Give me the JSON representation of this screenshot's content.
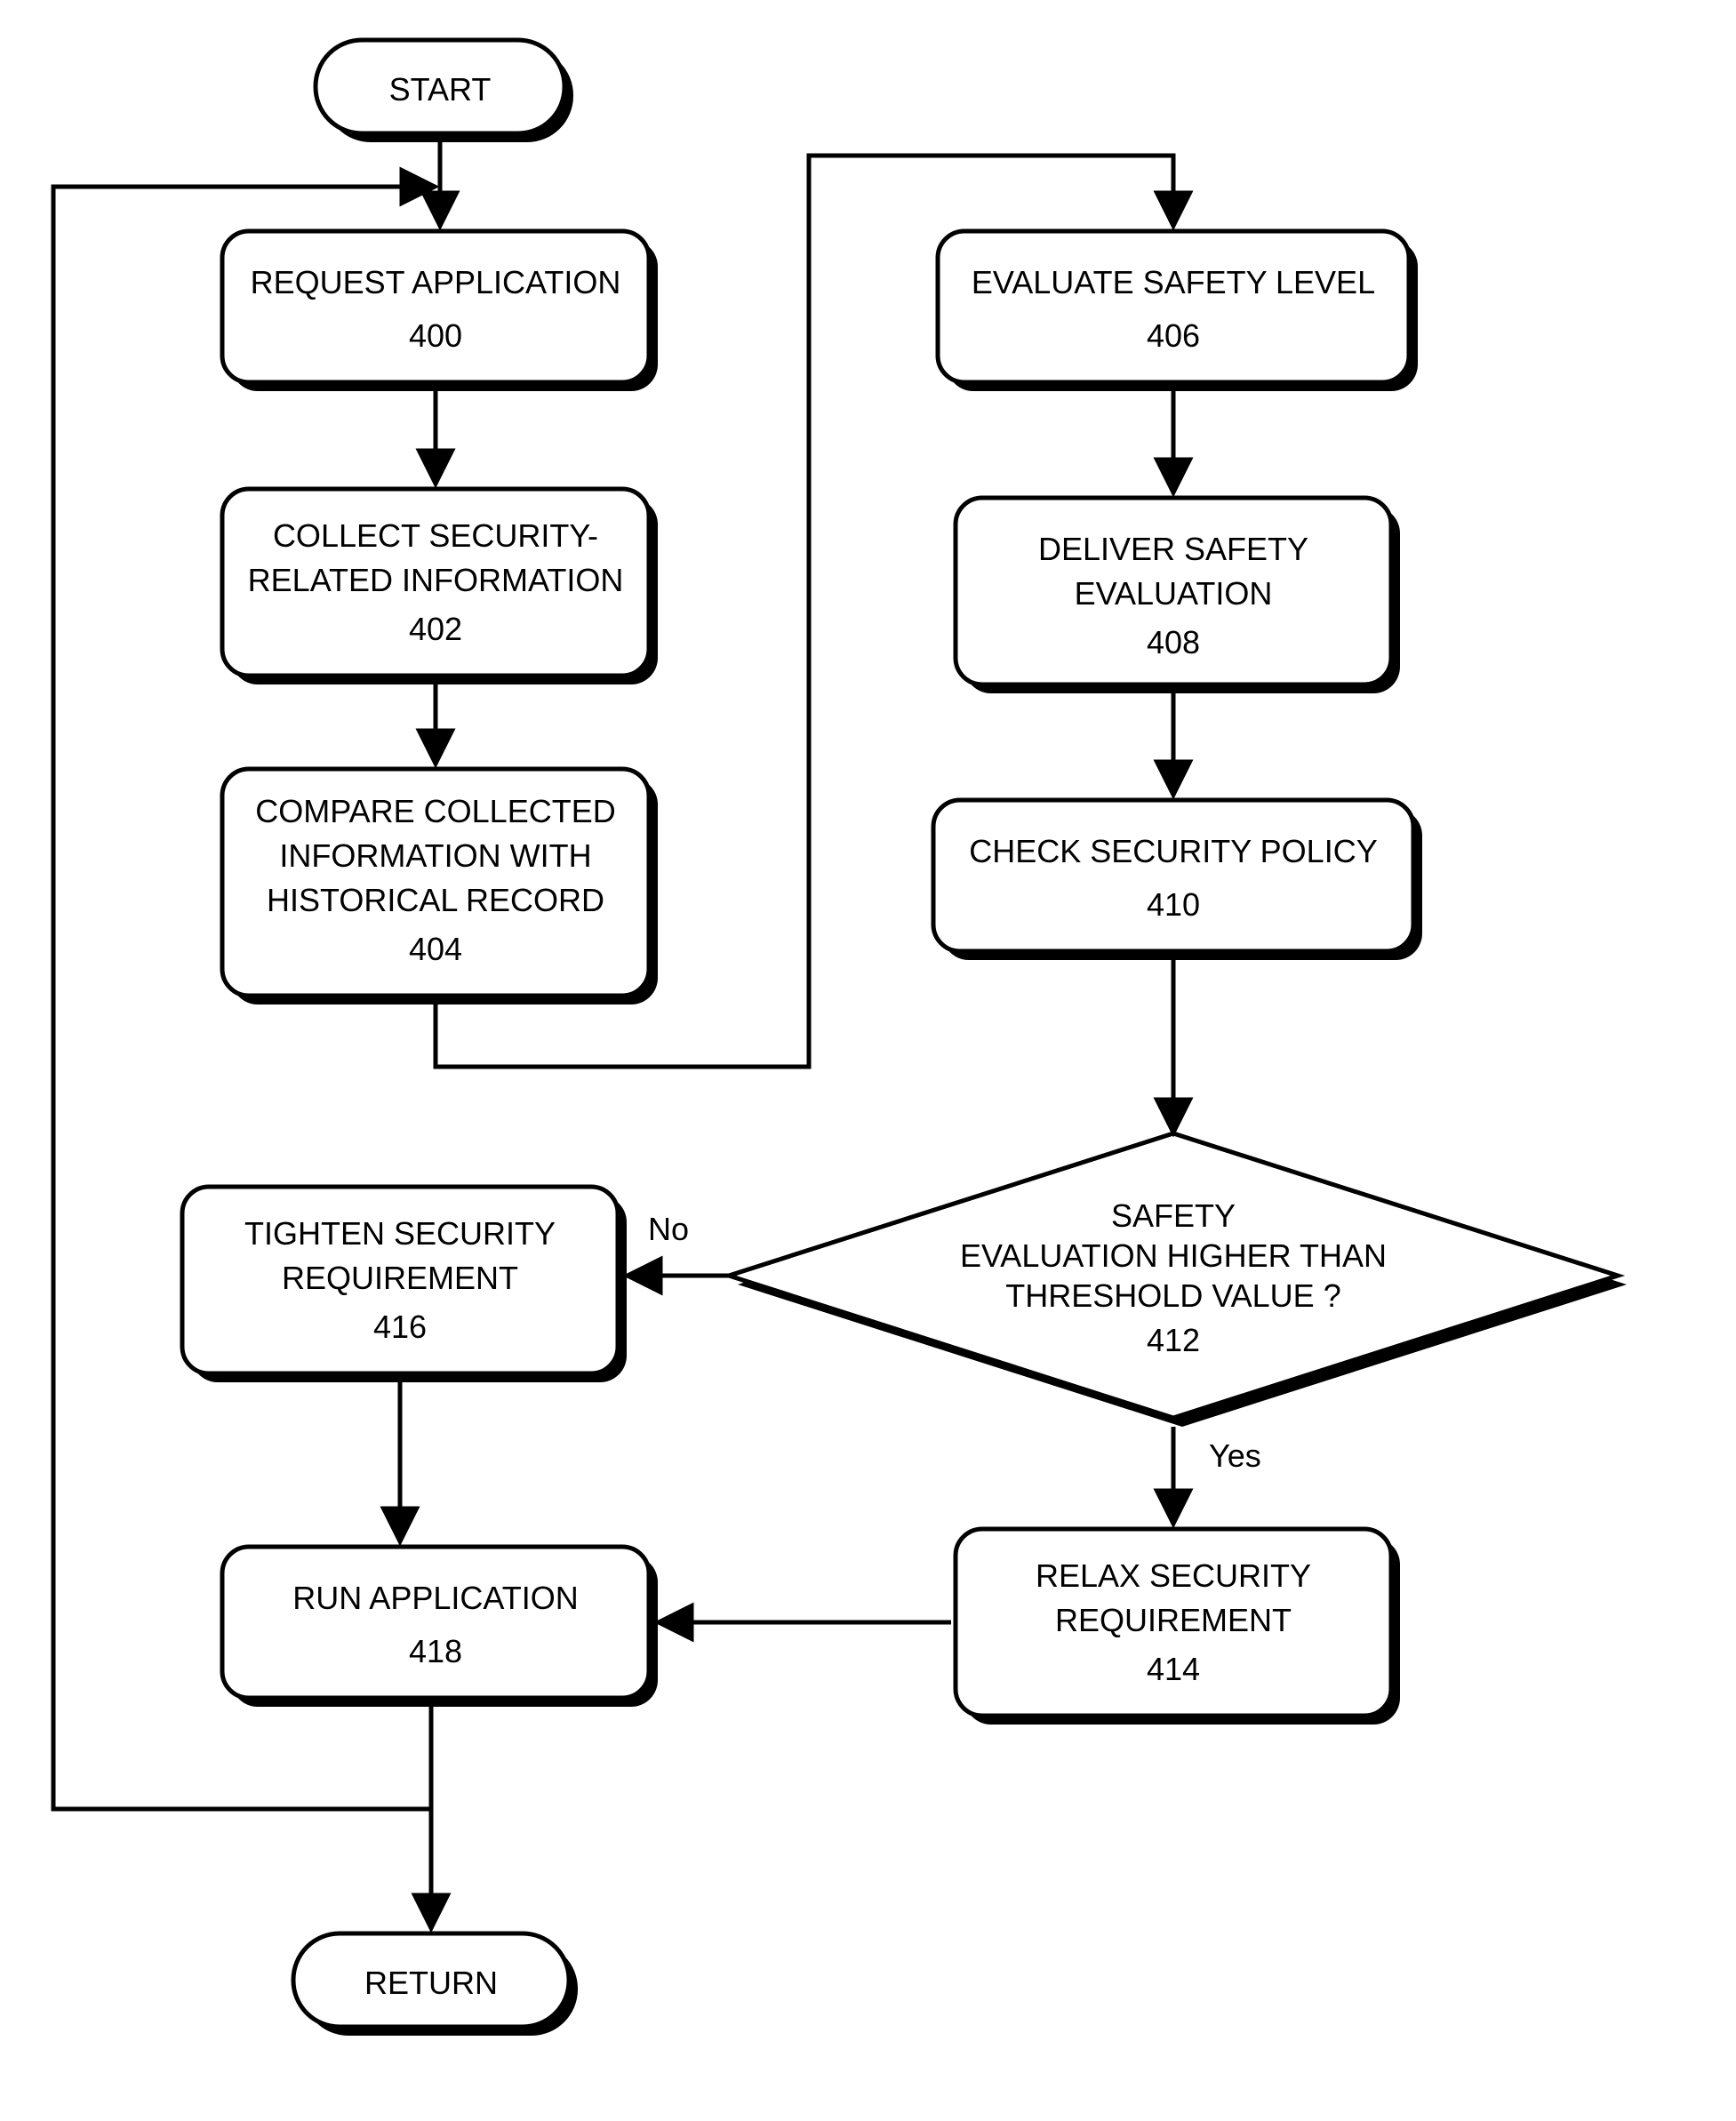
{
  "nodes": {
    "start": {
      "label": "START"
    },
    "return": {
      "label": "RETURN"
    },
    "n400": {
      "line1": "REQUEST APPLICATION",
      "ref": "400"
    },
    "n402": {
      "line1": "COLLECT SECURITY-",
      "line2": "RELATED INFORMATION",
      "ref": "402"
    },
    "n404": {
      "line1": "COMPARE COLLECTED",
      "line2": "INFORMATION WITH",
      "line3": "HISTORICAL RECORD",
      "ref": "404"
    },
    "n406": {
      "line1": "EVALUATE SAFETY LEVEL",
      "ref": "406"
    },
    "n408": {
      "line1": "DELIVER SAFETY",
      "line2": "EVALUATION",
      "ref": "408"
    },
    "n410": {
      "line1": "CHECK SECURITY POLICY",
      "ref": "410"
    },
    "n412": {
      "line1": "SAFETY",
      "line2": "EVALUATION HIGHER THAN",
      "line3": "THRESHOLD VALUE ?",
      "ref": "412"
    },
    "n414": {
      "line1": "RELAX SECURITY",
      "line2": "REQUIREMENT",
      "ref": "414"
    },
    "n416": {
      "line1": "TIGHTEN SECURITY",
      "line2": "REQUIREMENT",
      "ref": "416"
    },
    "n418": {
      "line1": "RUN APPLICATION",
      "ref": "418"
    }
  },
  "edges": {
    "no": "No",
    "yes": "Yes"
  }
}
